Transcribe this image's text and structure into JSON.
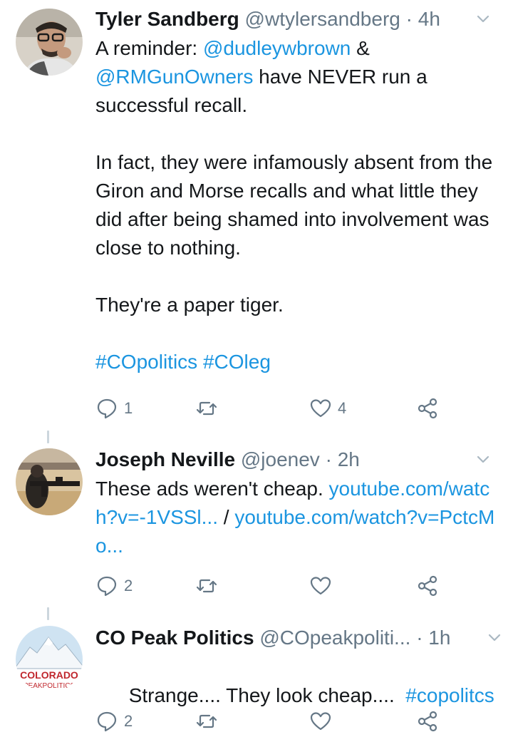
{
  "tweets": [
    {
      "name": "Tyler Sandberg",
      "handle": "@wtylersandberg",
      "separator": "·",
      "time": "4h",
      "body": {
        "line1_text": "A reminder: ",
        "mention1": "@dudleywbrown",
        "amp": " &",
        "mention2": "@RMGunOwners",
        "line2_rest": " have NEVER run a successful recall.",
        "para2": "In fact, they were infamously absent from the Giron and Morse recalls and what little they did after being shamed into involvement was close to nothing.",
        "para3": "They're a paper tiger.",
        "hashtag1": "#COpolitics",
        "hashtag2": "#COleg"
      },
      "replies": "1",
      "retweets": "",
      "likes": "4"
    },
    {
      "name": "Joseph Neville",
      "handle": "@joenev",
      "separator": "·",
      "time": "2h",
      "body": {
        "text": "These ads weren't cheap. ",
        "link1": "youtube.com/watch?v=-1VSSl...",
        "slash": " / ",
        "link2": "youtube.com/watch?v=PctcMo..."
      },
      "replies": "2",
      "retweets": "",
      "likes": ""
    },
    {
      "name": "CO Peak Politics",
      "handle": "@COpeakpoliti...",
      "separator": "·",
      "time": "1h",
      "body": {
        "text": "Strange.... They look cheap....  ",
        "hashtag": "#copolitcs"
      },
      "avatar_text1": "COLORADO",
      "avatar_text2": "PEAKPOLITICS",
      "replies": "2",
      "retweets": "",
      "likes": ""
    }
  ],
  "colors": {
    "link": "#1b95e0",
    "secondary": "#657786",
    "text": "#14171a"
  },
  "icons": [
    "reply-icon",
    "retweet-icon",
    "like-icon",
    "share-icon",
    "chevron-down-icon"
  ]
}
